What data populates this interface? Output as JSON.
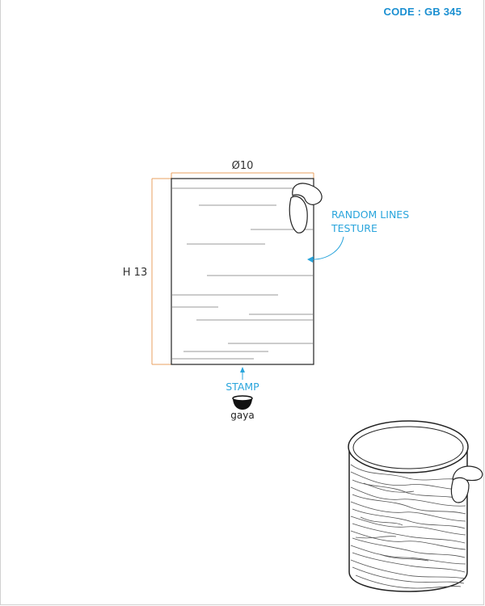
{
  "code": {
    "text": "CODE : GB 345",
    "color": "#1a8fd1"
  },
  "dimensions": {
    "diameter": "Ø10",
    "height": "H 13"
  },
  "annotations": {
    "texture_line1": "RANDOM LINES",
    "texture_line2": "TESTURE",
    "stamp": "STAMP",
    "brand": "gaya"
  },
  "colors": {
    "dimension_line": "#e8a060",
    "annotation": "#2aa5dc",
    "ink": "#222222"
  }
}
